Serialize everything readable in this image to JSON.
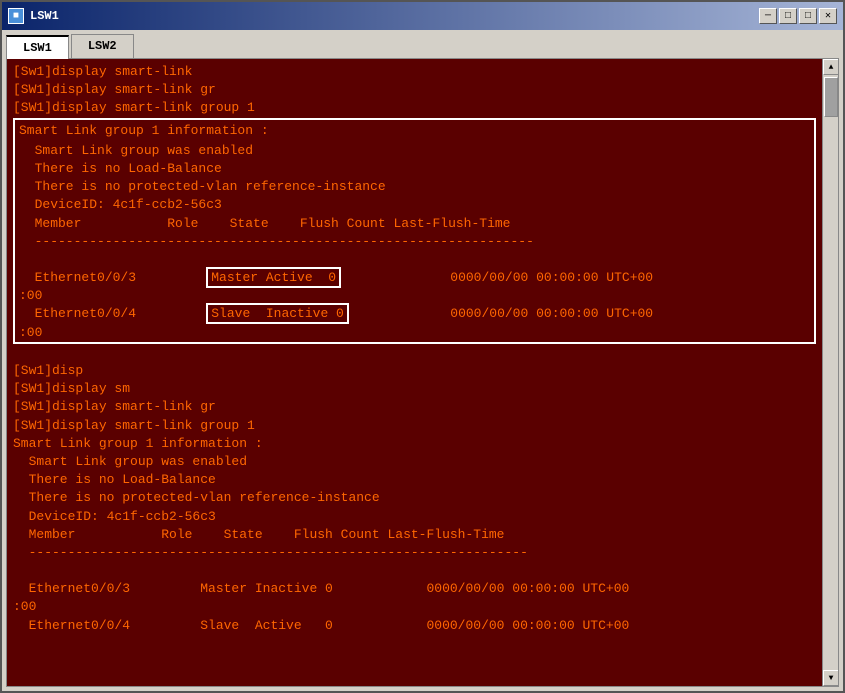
{
  "window": {
    "title": "LSW1",
    "tabs": [
      {
        "id": "lsw1",
        "label": "LSW1",
        "active": true
      },
      {
        "id": "lsw2",
        "label": "LSW2",
        "active": false
      }
    ]
  },
  "terminal": {
    "lines": [
      "[Sw1]display smart-link",
      "[SW1]display smart-link gr",
      "[SW1]display smart-link group 1",
      "Smart Link group 1 information :",
      "  Smart Link group was enabled",
      "  There is no Load-Balance",
      "  There is no protected-vlan reference-instance",
      "  DeviceID: 4c1f-ccb2-56c3",
      "  Member           Role    State    Flush Count Last-Flush-Time",
      "  ----------------------------------------------------------------",
      "",
      "  Ethernet0/0/3         Master Active  0              0000/00/00 00:00:00 UTC+00",
      ":00",
      "  Ethernet0/0/4         Slave  Inactive 0             0000/00/00 00:00:00 UTC+00",
      ":00",
      "",
      "[Sw1]disp",
      "[SW1]display sm",
      "[SW1]display smart-link gr",
      "[SW1]display smart-link group 1",
      "Smart Link group 1 information :",
      "  Smart Link group was enabled",
      "  There is no Load-Balance",
      "  There is no protected-vlan reference-instance",
      "  DeviceID: 4c1f-ccb2-56c3",
      "  Member           Role    State    Flush Count Last-Flush-Time",
      "  ----------------------------------------------------------------",
      "",
      "  Ethernet0/0/3         Master Inactive 0            0000/00/00 00:00:00 UTC+00",
      ":00",
      "  Ethernet0/0/4         Slave  Active   0            0000/00/00 00:00:00 UTC+00"
    ]
  },
  "highlights": {
    "box1": "Master Active  0",
    "box2": "Slave  Inactive 0"
  },
  "icons": {
    "minimize": "─",
    "maximize": "□",
    "close": "✕",
    "scroll_up": "▲",
    "scroll_down": "▼"
  }
}
